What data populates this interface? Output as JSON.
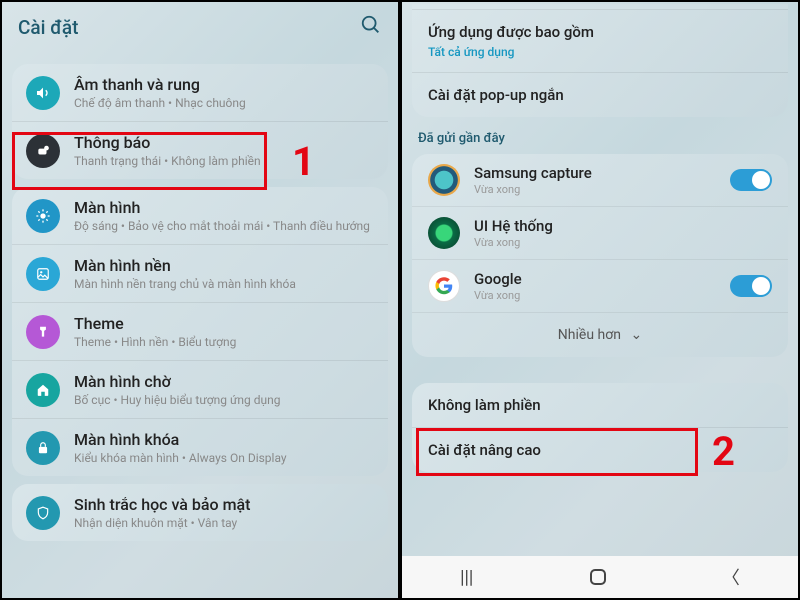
{
  "left": {
    "header_title": "Cài đặt",
    "items": [
      {
        "title": "Âm thanh và rung",
        "sub": "Chế độ âm thanh  •  Nhạc chuông"
      },
      {
        "title": "Thông báo",
        "sub": "Thanh trạng thái  •  Không làm phiền"
      },
      {
        "title": "Màn hình",
        "sub": "Độ sáng  •  Bảo vệ cho mắt thoải mái  •  Thanh điều hướng"
      },
      {
        "title": "Màn hình nền",
        "sub": "Màn hình nền trang chủ và màn hình khóa"
      },
      {
        "title": "Theme",
        "sub": "Theme  •  Hình nền  •  Biểu tượng"
      },
      {
        "title": "Màn hình chờ",
        "sub": "Bố cục  •  Huy hiệu biểu tượng ứng dụng"
      },
      {
        "title": "Màn hình khóa",
        "sub": "Kiểu khóa màn hình  •  Always On Display"
      },
      {
        "title": "Sinh trắc học và bảo mật",
        "sub": "Nhận diện khuôn mặt  •  Vân tay"
      }
    ],
    "marker": "1"
  },
  "right": {
    "top": {
      "apps_title": "Ứng dụng được bao gồm",
      "apps_sub": "Tất cả ứng dụng",
      "popup_title": "Cài đặt pop-up ngắn"
    },
    "recent_label": "Đã gửi gần đây",
    "apps": [
      {
        "name": "Samsung capture",
        "sub": "Vừa xong",
        "toggle": true
      },
      {
        "name": "UI Hệ thống",
        "sub": "Vừa xong",
        "toggle": false
      },
      {
        "name": "Google",
        "sub": "Vừa xong",
        "toggle": true
      }
    ],
    "more": "Nhiều hơn",
    "bottom": {
      "dnd": "Không làm phiền",
      "adv": "Cài đặt nâng cao"
    },
    "marker": "2"
  }
}
